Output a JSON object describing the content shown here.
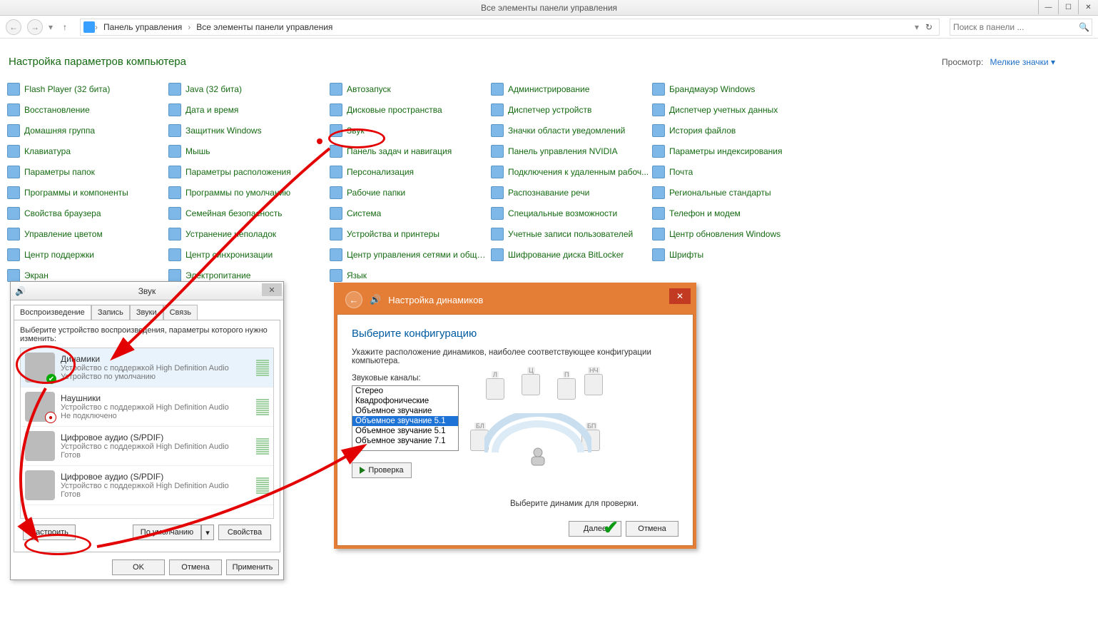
{
  "window": {
    "title": "Все элементы панели управления",
    "min": "—",
    "max": "☐",
    "close": "✕"
  },
  "nav": {
    "back": "←",
    "fwd": "→",
    "up": "↑",
    "refresh": "↻",
    "breadcrumb": [
      "Панель управления",
      "Все элементы панели управления"
    ],
    "search_placeholder": "Поиск в панели ..."
  },
  "header": {
    "heading": "Настройка параметров компьютера",
    "view_label": "Просмотр:",
    "view_mode": "Мелкие значки ▾"
  },
  "items": [
    "Flash Player (32 бита)",
    "Java (32 бита)",
    "Автозапуск",
    "Администрирование",
    "Брандмауэр Windows",
    "Восстановление",
    "Дата и время",
    "Дисковые пространства",
    "Диспетчер устройств",
    "Диспетчер учетных данных",
    "Домашняя группа",
    "Защитник Windows",
    "Звук",
    "Значки области уведомлений",
    "История файлов",
    "Клавиатура",
    "Мышь",
    "Панель задач и навигация",
    "Панель управления NVIDIA",
    "Параметры индексирования",
    "Параметры папок",
    "Параметры расположения",
    "Персонализация",
    "Подключения к удаленным рабоч...",
    "Почта",
    "Программы и компоненты",
    "Программы по умолчанию",
    "Рабочие папки",
    "Распознавание речи",
    "Региональные стандарты",
    "Свойства браузера",
    "Семейная безопасность",
    "Система",
    "Специальные возможности",
    "Телефон и модем",
    "Управление цветом",
    "Устранение неполадок",
    "Устройства и принтеры",
    "Учетные записи пользователей",
    "Центр обновления Windows",
    "Центр поддержки",
    "Центр синхронизации",
    "Центр управления сетями и общи...",
    "Шифрование диска BitLocker",
    "Шрифты",
    "Экран",
    "Электропитание",
    "Язык"
  ],
  "sound": {
    "title": "Звук",
    "tabs": [
      "Воспроизведение",
      "Запись",
      "Звуки",
      "Связь"
    ],
    "instruction": "Выберите устройство воспроизведения, параметры которого нужно изменить:",
    "devices": [
      {
        "name": "Динамики",
        "sub": "Устройство с поддержкой High Definition Audio",
        "status": "Устройство по умолчанию",
        "mark": "green"
      },
      {
        "name": "Наушники",
        "sub": "Устройство с поддержкой High Definition Audio",
        "status": "Не подключено",
        "mark": "red"
      },
      {
        "name": "Цифровое аудио (S/PDIF)",
        "sub": "Устройство с поддержкой High Definition Audio",
        "status": "Готов",
        "mark": ""
      },
      {
        "name": "Цифровое аудио (S/PDIF)",
        "sub": "Устройство с поддержкой High Definition Audio",
        "status": "Готов",
        "mark": ""
      }
    ],
    "configure": "Настроить",
    "default": "По умолчанию",
    "properties": "Свойства",
    "ok": "OK",
    "cancel": "Отмена",
    "apply": "Применить"
  },
  "wizard": {
    "title": "Настройка динамиков",
    "heading": "Выберите конфигурацию",
    "desc": "Укажите расположение динамиков, наиболее соответствующее конфигурации компьютера.",
    "channels_label": "Звуковые каналы:",
    "options": [
      "Стерео",
      "Квадрофонические",
      "Объемное звучание",
      "Объемное звучание 5.1",
      "Объемное звучание 5.1",
      "Объемное звучание 7.1"
    ],
    "selected_index": 3,
    "test": "Проверка",
    "caption": "Выберите динамик для проверки.",
    "next": "Далее",
    "cancel": "Отмена",
    "spk_labels": [
      "Л",
      "Ц",
      "П",
      "НЧ",
      "БЛ",
      "БП"
    ]
  }
}
